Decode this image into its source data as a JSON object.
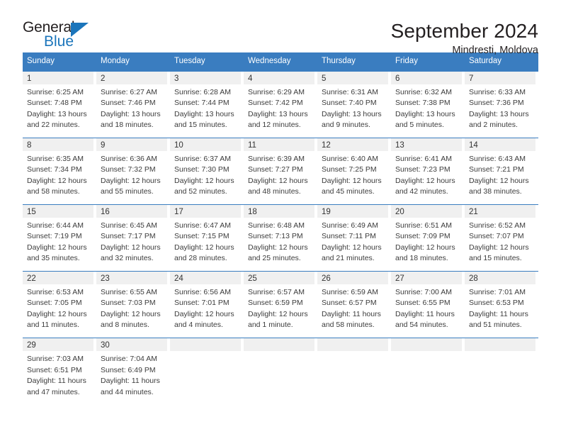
{
  "brand": {
    "name_part1": "General",
    "name_part2": "Blue",
    "triangle_icon": "brand-triangle-icon",
    "accent_color": "#1b75bb"
  },
  "header": {
    "title": "September 2024",
    "subtitle": "Mindresti, Moldova"
  },
  "theme": {
    "header_blue": "#3a7dc0",
    "day_band_gray": "#f0f0f0",
    "text_color": "#3c3c3c"
  },
  "weekdays": [
    "Sunday",
    "Monday",
    "Tuesday",
    "Wednesday",
    "Thursday",
    "Friday",
    "Saturday"
  ],
  "weeks": [
    [
      {
        "day": "1",
        "sunrise": "Sunrise: 6:25 AM",
        "sunset": "Sunset: 7:48 PM",
        "daylight_line1": "Daylight: 13 hours",
        "daylight_line2": "and 22 minutes."
      },
      {
        "day": "2",
        "sunrise": "Sunrise: 6:27 AM",
        "sunset": "Sunset: 7:46 PM",
        "daylight_line1": "Daylight: 13 hours",
        "daylight_line2": "and 18 minutes."
      },
      {
        "day": "3",
        "sunrise": "Sunrise: 6:28 AM",
        "sunset": "Sunset: 7:44 PM",
        "daylight_line1": "Daylight: 13 hours",
        "daylight_line2": "and 15 minutes."
      },
      {
        "day": "4",
        "sunrise": "Sunrise: 6:29 AM",
        "sunset": "Sunset: 7:42 PM",
        "daylight_line1": "Daylight: 13 hours",
        "daylight_line2": "and 12 minutes."
      },
      {
        "day": "5",
        "sunrise": "Sunrise: 6:31 AM",
        "sunset": "Sunset: 7:40 PM",
        "daylight_line1": "Daylight: 13 hours",
        "daylight_line2": "and 9 minutes."
      },
      {
        "day": "6",
        "sunrise": "Sunrise: 6:32 AM",
        "sunset": "Sunset: 7:38 PM",
        "daylight_line1": "Daylight: 13 hours",
        "daylight_line2": "and 5 minutes."
      },
      {
        "day": "7",
        "sunrise": "Sunrise: 6:33 AM",
        "sunset": "Sunset: 7:36 PM",
        "daylight_line1": "Daylight: 13 hours",
        "daylight_line2": "and 2 minutes."
      }
    ],
    [
      {
        "day": "8",
        "sunrise": "Sunrise: 6:35 AM",
        "sunset": "Sunset: 7:34 PM",
        "daylight_line1": "Daylight: 12 hours",
        "daylight_line2": "and 58 minutes."
      },
      {
        "day": "9",
        "sunrise": "Sunrise: 6:36 AM",
        "sunset": "Sunset: 7:32 PM",
        "daylight_line1": "Daylight: 12 hours",
        "daylight_line2": "and 55 minutes."
      },
      {
        "day": "10",
        "sunrise": "Sunrise: 6:37 AM",
        "sunset": "Sunset: 7:30 PM",
        "daylight_line1": "Daylight: 12 hours",
        "daylight_line2": "and 52 minutes."
      },
      {
        "day": "11",
        "sunrise": "Sunrise: 6:39 AM",
        "sunset": "Sunset: 7:27 PM",
        "daylight_line1": "Daylight: 12 hours",
        "daylight_line2": "and 48 minutes."
      },
      {
        "day": "12",
        "sunrise": "Sunrise: 6:40 AM",
        "sunset": "Sunset: 7:25 PM",
        "daylight_line1": "Daylight: 12 hours",
        "daylight_line2": "and 45 minutes."
      },
      {
        "day": "13",
        "sunrise": "Sunrise: 6:41 AM",
        "sunset": "Sunset: 7:23 PM",
        "daylight_line1": "Daylight: 12 hours",
        "daylight_line2": "and 42 minutes."
      },
      {
        "day": "14",
        "sunrise": "Sunrise: 6:43 AM",
        "sunset": "Sunset: 7:21 PM",
        "daylight_line1": "Daylight: 12 hours",
        "daylight_line2": "and 38 minutes."
      }
    ],
    [
      {
        "day": "15",
        "sunrise": "Sunrise: 6:44 AM",
        "sunset": "Sunset: 7:19 PM",
        "daylight_line1": "Daylight: 12 hours",
        "daylight_line2": "and 35 minutes."
      },
      {
        "day": "16",
        "sunrise": "Sunrise: 6:45 AM",
        "sunset": "Sunset: 7:17 PM",
        "daylight_line1": "Daylight: 12 hours",
        "daylight_line2": "and 32 minutes."
      },
      {
        "day": "17",
        "sunrise": "Sunrise: 6:47 AM",
        "sunset": "Sunset: 7:15 PM",
        "daylight_line1": "Daylight: 12 hours",
        "daylight_line2": "and 28 minutes."
      },
      {
        "day": "18",
        "sunrise": "Sunrise: 6:48 AM",
        "sunset": "Sunset: 7:13 PM",
        "daylight_line1": "Daylight: 12 hours",
        "daylight_line2": "and 25 minutes."
      },
      {
        "day": "19",
        "sunrise": "Sunrise: 6:49 AM",
        "sunset": "Sunset: 7:11 PM",
        "daylight_line1": "Daylight: 12 hours",
        "daylight_line2": "and 21 minutes."
      },
      {
        "day": "20",
        "sunrise": "Sunrise: 6:51 AM",
        "sunset": "Sunset: 7:09 PM",
        "daylight_line1": "Daylight: 12 hours",
        "daylight_line2": "and 18 minutes."
      },
      {
        "day": "21",
        "sunrise": "Sunrise: 6:52 AM",
        "sunset": "Sunset: 7:07 PM",
        "daylight_line1": "Daylight: 12 hours",
        "daylight_line2": "and 15 minutes."
      }
    ],
    [
      {
        "day": "22",
        "sunrise": "Sunrise: 6:53 AM",
        "sunset": "Sunset: 7:05 PM",
        "daylight_line1": "Daylight: 12 hours",
        "daylight_line2": "and 11 minutes."
      },
      {
        "day": "23",
        "sunrise": "Sunrise: 6:55 AM",
        "sunset": "Sunset: 7:03 PM",
        "daylight_line1": "Daylight: 12 hours",
        "daylight_line2": "and 8 minutes."
      },
      {
        "day": "24",
        "sunrise": "Sunrise: 6:56 AM",
        "sunset": "Sunset: 7:01 PM",
        "daylight_line1": "Daylight: 12 hours",
        "daylight_line2": "and 4 minutes."
      },
      {
        "day": "25",
        "sunrise": "Sunrise: 6:57 AM",
        "sunset": "Sunset: 6:59 PM",
        "daylight_line1": "Daylight: 12 hours",
        "daylight_line2": "and 1 minute."
      },
      {
        "day": "26",
        "sunrise": "Sunrise: 6:59 AM",
        "sunset": "Sunset: 6:57 PM",
        "daylight_line1": "Daylight: 11 hours",
        "daylight_line2": "and 58 minutes."
      },
      {
        "day": "27",
        "sunrise": "Sunrise: 7:00 AM",
        "sunset": "Sunset: 6:55 PM",
        "daylight_line1": "Daylight: 11 hours",
        "daylight_line2": "and 54 minutes."
      },
      {
        "day": "28",
        "sunrise": "Sunrise: 7:01 AM",
        "sunset": "Sunset: 6:53 PM",
        "daylight_line1": "Daylight: 11 hours",
        "daylight_line2": "and 51 minutes."
      }
    ],
    [
      {
        "day": "29",
        "sunrise": "Sunrise: 7:03 AM",
        "sunset": "Sunset: 6:51 PM",
        "daylight_line1": "Daylight: 11 hours",
        "daylight_line2": "and 47 minutes."
      },
      {
        "day": "30",
        "sunrise": "Sunrise: 7:04 AM",
        "sunset": "Sunset: 6:49 PM",
        "daylight_line1": "Daylight: 11 hours",
        "daylight_line2": "and 44 minutes."
      },
      {
        "day": "",
        "sunrise": "",
        "sunset": "",
        "daylight_line1": "",
        "daylight_line2": ""
      },
      {
        "day": "",
        "sunrise": "",
        "sunset": "",
        "daylight_line1": "",
        "daylight_line2": ""
      },
      {
        "day": "",
        "sunrise": "",
        "sunset": "",
        "daylight_line1": "",
        "daylight_line2": ""
      },
      {
        "day": "",
        "sunrise": "",
        "sunset": "",
        "daylight_line1": "",
        "daylight_line2": ""
      },
      {
        "day": "",
        "sunrise": "",
        "sunset": "",
        "daylight_line1": "",
        "daylight_line2": ""
      }
    ]
  ]
}
